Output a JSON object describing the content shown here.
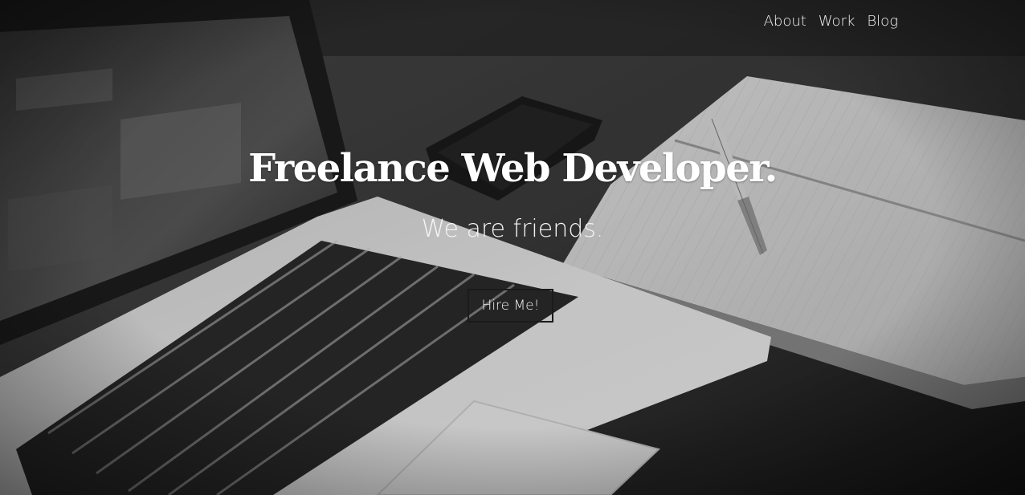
{
  "nav": {
    "items": [
      {
        "label": "About"
      },
      {
        "label": "Work"
      },
      {
        "label": "Blog"
      }
    ]
  },
  "hero": {
    "headline": "Freelance Web Developer.",
    "tagline": "We are friends.",
    "cta_label": "Hire Me!"
  },
  "background": {
    "subject": "laptop-notebook-pen-phone-desk-photo",
    "tone": "grayscale"
  }
}
